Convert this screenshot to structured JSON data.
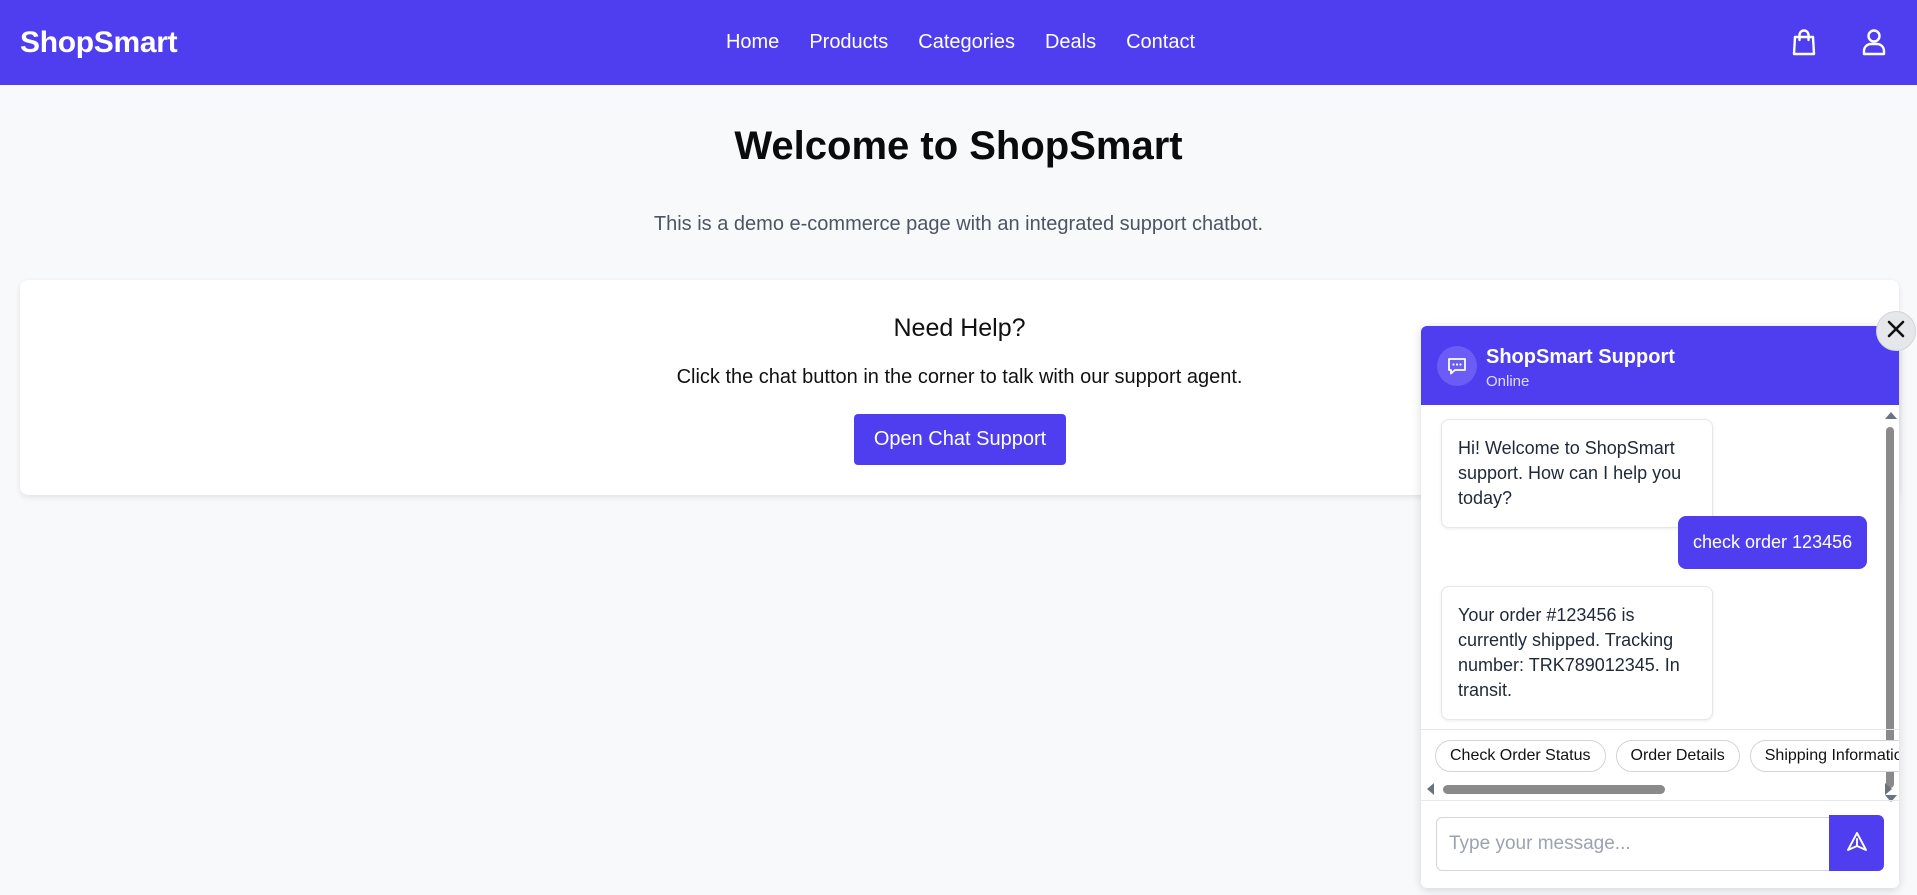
{
  "brand": "ShopSmart",
  "nav": {
    "links": [
      "Home",
      "Products",
      "Categories",
      "Deals",
      "Contact"
    ],
    "icons": [
      "shopping-bag-icon",
      "user-icon"
    ]
  },
  "main": {
    "title": "Welcome to ShopSmart",
    "subtitle": "This is a demo e-commerce page with an integrated support chatbot.",
    "help_card": {
      "title": "Need Help?",
      "text": "Click the chat button in the corner to talk with our support agent.",
      "button": "Open Chat Support"
    }
  },
  "chat": {
    "name": "ShopSmart Support",
    "status": "Online",
    "messages": [
      {
        "from": "bot",
        "text": "Hi! Welcome to ShopSmart support. How can I help you today?"
      },
      {
        "from": "user",
        "text": "check order 123456"
      },
      {
        "from": "bot",
        "text": "Your order #123456 is currently shipped. Tracking number: TRK789012345. In transit."
      }
    ],
    "quick_replies": [
      "Check Order Status",
      "Order Details",
      "Shipping Information"
    ],
    "input_placeholder": "Type your message...",
    "input_value": ""
  },
  "colors": {
    "primary": "#4f3ef0",
    "background": "#f8f9fb"
  }
}
